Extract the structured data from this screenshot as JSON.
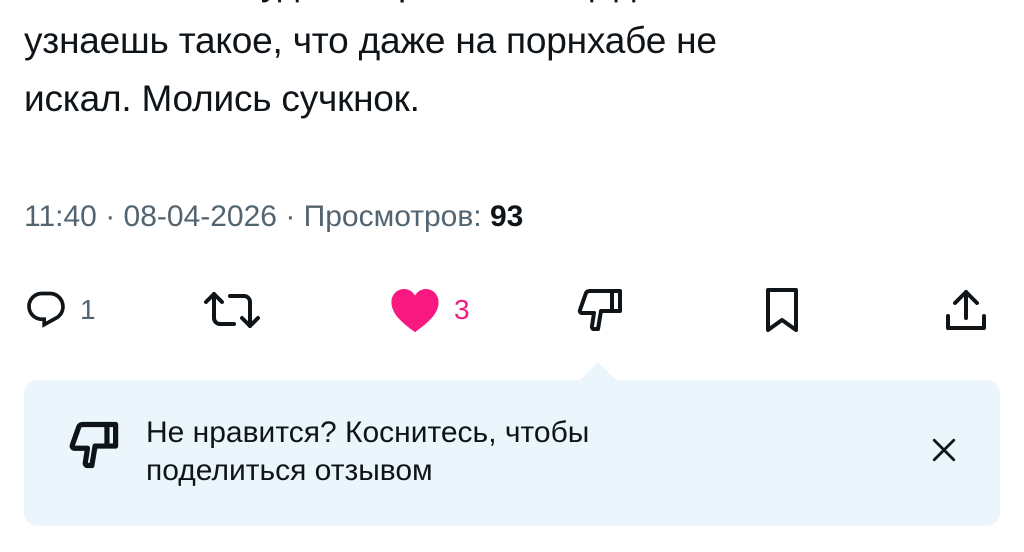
{
  "tweet": {
    "text_lines": [
      "мальчик. Ты будешь просить пощады. Ты",
      "узнаешь такое, что даже на порнхабе не",
      "искал. Молись сучкнок."
    ],
    "time": "11:40",
    "separator": " · ",
    "date": "08-04-2026",
    "views_label": "Просмотров: ",
    "views_count": "93"
  },
  "actions": {
    "reply": {
      "icon": "reply-icon",
      "count": "1"
    },
    "retweet": {
      "icon": "retweet-icon"
    },
    "like": {
      "icon": "heart-icon",
      "count": "3",
      "liked": true,
      "color": "#f91880"
    },
    "dislike": {
      "icon": "thumbs-down-icon"
    },
    "bookmark": {
      "icon": "bookmark-icon"
    },
    "share": {
      "icon": "share-icon"
    }
  },
  "feedback_banner": {
    "icon": "thumbs-down-icon",
    "text_line1": "Не нравится? Коснитесь, чтобы",
    "text_line2": "поделиться отзывом",
    "close_icon": "close-icon",
    "background": "#eaf6fc"
  },
  "colors": {
    "text": "#0f1419",
    "secondary": "#536471",
    "like": "#f91880"
  }
}
